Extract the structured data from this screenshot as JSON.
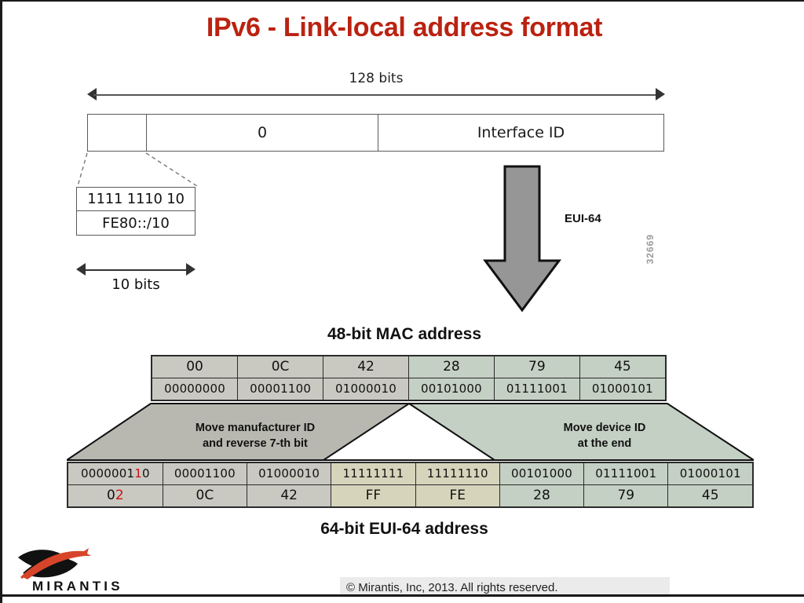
{
  "slide": {
    "title": "IPv6 - Link-local address format"
  },
  "top_diagram": {
    "width_label": "128 bits",
    "address_box": {
      "prefix_cell": "",
      "zero_cell": "0",
      "interface_cell": "Interface ID"
    },
    "detail_box": {
      "bits": "1111 1110 10",
      "prefix": "FE80::/10"
    },
    "detail_width_label": "10 bits",
    "conversion_label": "EUI-64",
    "figure_number": "32669"
  },
  "mac_section": {
    "caption": "48-bit MAC address",
    "hex_row": [
      "00",
      "0C",
      "42",
      "28",
      "79",
      "45"
    ],
    "bin_row": [
      "00000000",
      "00001100",
      "01000010",
      "00101000",
      "01111001",
      "01000101"
    ],
    "cell_colors": [
      "c-gray",
      "c-gray",
      "c-gray",
      "c-green",
      "c-green",
      "c-green"
    ]
  },
  "band": {
    "left_text_line1": "Move manufacturer ID",
    "left_text_line2": "and reverse 7-th bit",
    "right_text_line1": "Move device ID",
    "right_text_line2": "at the end"
  },
  "eui_section": {
    "caption": "64-bit EUI-64 address",
    "bin_row": [
      "00000010",
      "00001100",
      "01000010",
      "11111111",
      "11111110",
      "00101000",
      "01111001",
      "01000101"
    ],
    "hex_row": [
      "02",
      "0C",
      "42",
      "FF",
      "FE",
      "28",
      "79",
      "45"
    ],
    "cell_colors": [
      "c-gray",
      "c-gray",
      "c-gray",
      "c-beige",
      "c-beige",
      "c-green",
      "c-green",
      "c-green"
    ],
    "highlighted_bin_prefix": "0000001",
    "highlighted_bin_redchar": "1",
    "highlighted_bin_suffix": "0",
    "highlighted_hex_prefix": "0",
    "highlighted_hex_redchar": "2"
  },
  "footer": {
    "copyright": "© Mirantis, Inc, 2013. All rights reserved.",
    "logo_wordmark": "MIRANTIS"
  },
  "colors": {
    "title_red": "#bb2211",
    "gray_cell": "#c9c9c1",
    "green_cell": "#c4d0c3",
    "beige_cell": "#d6d5bc",
    "highlight_red": "#cc1111",
    "logo_red": "#d6452a"
  }
}
